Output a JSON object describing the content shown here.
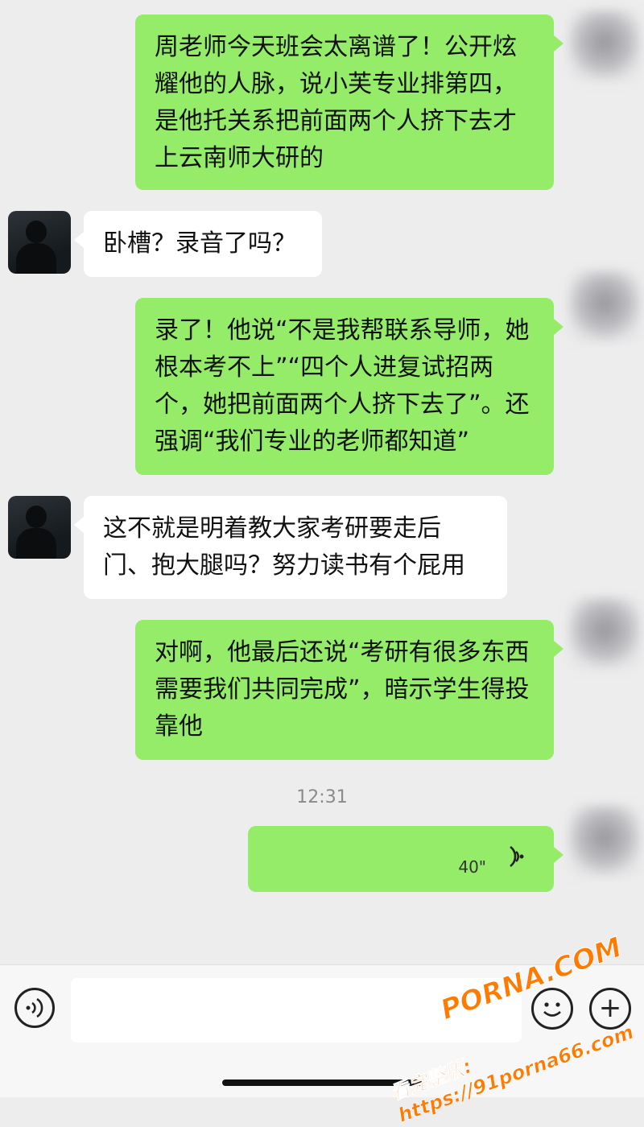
{
  "messages": [
    {
      "from": "me",
      "text": "周老师今天班会太离谱了！公开炫耀他的人脉，说小芙专业排第四，是他托关系把前面两个人挤下去才上云南师大研的"
    },
    {
      "from": "other",
      "text": "卧槽？录音了吗？"
    },
    {
      "from": "me",
      "text": "录了！他说“不是我帮联系导师，她根本考不上”“四个人进复试招两个，她把前面两个人挤下去了”。还强调“我们专业的老师都知道”"
    },
    {
      "from": "other",
      "text": "这不就是明着教大家考研要走后门、抱大腿吗？努力读书有个屁用"
    },
    {
      "from": "me",
      "text": "对啊，他最后还说“考研有很多东西需要我们共同完成”，暗示学生得投靠他"
    }
  ],
  "timestamp": "12:31",
  "voice_message": {
    "duration": "40\""
  },
  "input": {
    "placeholder": ""
  },
  "icons": {
    "voice_button": "voice-wave-icon",
    "emoji_button": "emoji-icon",
    "plus_button": "plus-icon",
    "voice_play": "voice-play-icon"
  },
  "watermark": {
    "brand": "PORNA.COM",
    "url_line": "看完整版: https://91porna66.com"
  },
  "colors": {
    "my_bubble": "#95ec69",
    "other_bubble": "#ffffff",
    "background": "#ededed",
    "watermark": "#ff7a00"
  }
}
